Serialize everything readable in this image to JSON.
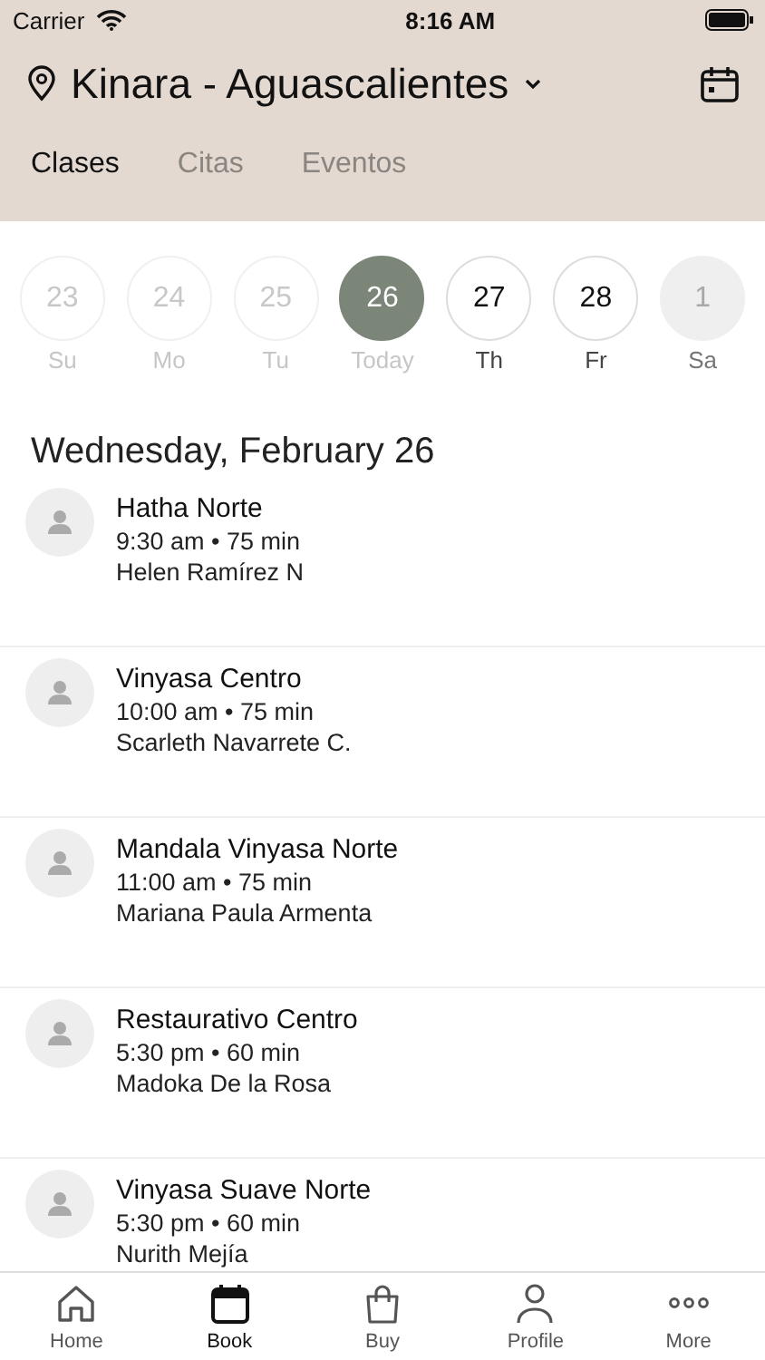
{
  "status_bar": {
    "carrier": "Carrier",
    "time": "8:16 AM"
  },
  "header": {
    "location": "Kinara - Aguascalientes"
  },
  "tabs": [
    {
      "label": "Clases",
      "selected": true
    },
    {
      "label": "Citas",
      "selected": false
    },
    {
      "label": "Eventos",
      "selected": false
    }
  ],
  "days": [
    {
      "number": "23",
      "label": "Su",
      "kind": "past",
      "selected": false
    },
    {
      "number": "24",
      "label": "Mo",
      "kind": "past",
      "selected": false
    },
    {
      "number": "25",
      "label": "Tu",
      "kind": "past",
      "selected": false
    },
    {
      "number": "26",
      "label": "Today",
      "kind": "past",
      "selected": true
    },
    {
      "number": "27",
      "label": "Th",
      "kind": "open",
      "selected": false
    },
    {
      "number": "28",
      "label": "Fr",
      "kind": "open",
      "selected": false
    },
    {
      "number": "1",
      "label": "Sa",
      "kind": "closed",
      "selected": false
    }
  ],
  "date_heading": "Wednesday, February 26",
  "classes": [
    {
      "name": "Hatha Norte",
      "time": "9:30 am • 75 min",
      "teacher": "Helen Ramírez N"
    },
    {
      "name": "Vinyasa Centro",
      "time": "10:00 am • 75 min",
      "teacher": "Scarleth Navarrete C."
    },
    {
      "name": "Mandala Vinyasa Norte",
      "time": "11:00 am • 75 min",
      "teacher": "Mariana Paula Armenta"
    },
    {
      "name": "Restaurativo Centro",
      "time": "5:30 pm • 60 min",
      "teacher": "Madoka De la Rosa"
    },
    {
      "name": "Vinyasa Suave Norte",
      "time": "5:30 pm • 60 min",
      "teacher": "Nurith Mejía"
    }
  ],
  "nav": [
    {
      "label": "Home",
      "kind": "home",
      "selected": false
    },
    {
      "label": "Book",
      "kind": "book",
      "selected": true
    },
    {
      "label": "Buy",
      "kind": "buy",
      "selected": false
    },
    {
      "label": "Profile",
      "kind": "profile",
      "selected": false
    },
    {
      "label": "More",
      "kind": "more",
      "selected": false
    }
  ]
}
